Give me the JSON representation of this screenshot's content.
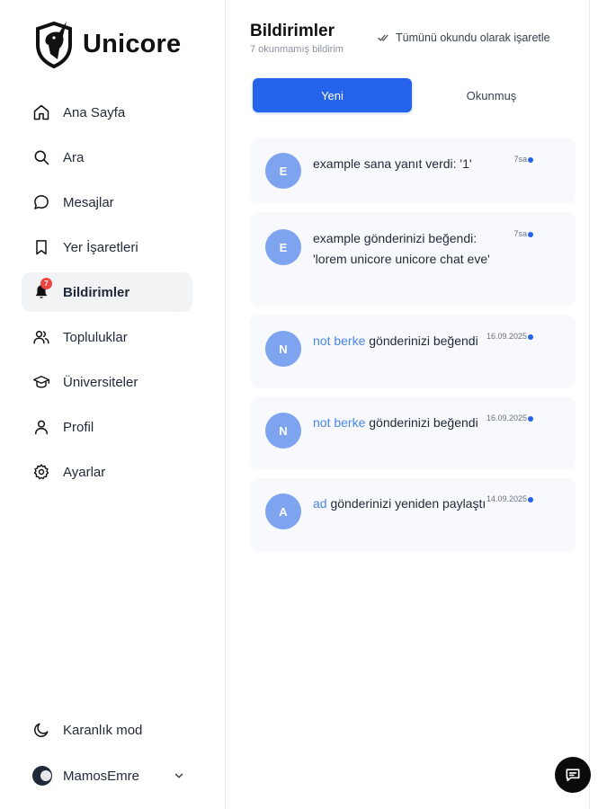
{
  "app": {
    "name": "Unicore"
  },
  "sidebar": {
    "items": [
      {
        "label": "Ana Sayfa",
        "icon": "home-icon"
      },
      {
        "label": "Ara",
        "icon": "search-icon"
      },
      {
        "label": "Mesajlar",
        "icon": "message-icon"
      },
      {
        "label": "Yer İşaretleri",
        "icon": "bookmark-icon"
      },
      {
        "label": "Bildirimler",
        "icon": "bell-icon",
        "active": true,
        "badge": "7"
      },
      {
        "label": "Topluluklar",
        "icon": "users-icon"
      },
      {
        "label": "Üniversiteler",
        "icon": "graduation-cap-icon"
      },
      {
        "label": "Profil",
        "icon": "user-icon"
      },
      {
        "label": "Ayarlar",
        "icon": "gear-icon"
      }
    ],
    "dark_mode_label": "Karanlık mod",
    "user_name": "MamosEmre"
  },
  "header": {
    "title": "Bildirimler",
    "subtitle": "7 okunmamış bildirim",
    "mark_all_label": "Tümünü okundu olarak işaretle"
  },
  "tabs": [
    {
      "label": "Yeni",
      "active": true
    },
    {
      "label": "Okunmuş",
      "active": false
    }
  ],
  "notifications": [
    {
      "initial": "E",
      "actor": "",
      "text": "example sana yanıt verdi: '1'",
      "time": "7sa",
      "unread": true
    },
    {
      "initial": "E",
      "actor": "",
      "text": "example gönderinizi beğendi: 'lorem unicore unicore chat eve'",
      "time": "7sa",
      "unread": true
    },
    {
      "initial": "N",
      "actor": "not berke",
      "text": " gönderinizi beğendi",
      "time": "16.09.2025",
      "unread": true
    },
    {
      "initial": "N",
      "actor": "not berke",
      "text": " gönderinizi beğendi",
      "time": "16.09.2025",
      "unread": true
    },
    {
      "initial": "A",
      "actor": "ad",
      "text": " gönderinizi yeniden paylaştı",
      "time": "14.09.2025",
      "unread": true
    }
  ],
  "colors": {
    "accent": "#2563eb",
    "avatar": "#7fa4ef",
    "actor_link": "#4a86e8",
    "badge": "#ef4444"
  }
}
